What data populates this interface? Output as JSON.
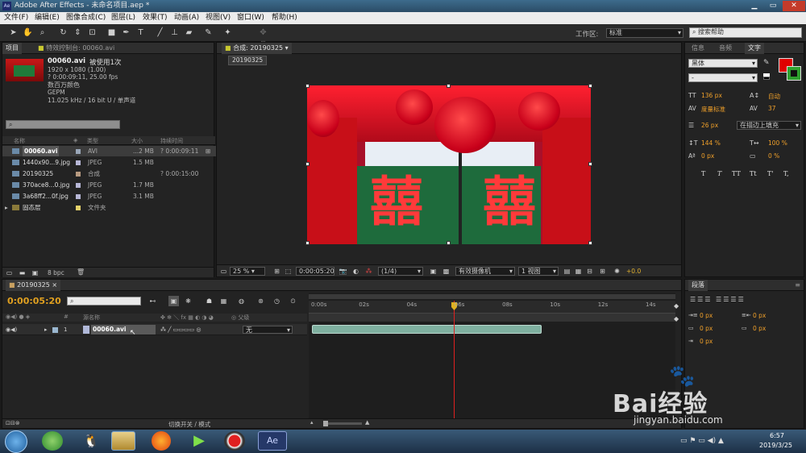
{
  "window": {
    "title": "Adobe After Effects - 未命名项目.aep *",
    "app_icon": "Ae"
  },
  "menu": [
    "文件(F)",
    "编辑(E)",
    "图像合成(C)",
    "图层(L)",
    "效果(T)",
    "动画(A)",
    "视图(V)",
    "窗口(W)",
    "帮助(H)"
  ],
  "toolbar": {
    "workspace_label": "工作区:",
    "workspace_value": "标准",
    "search_help_placeholder": "搜索帮助"
  },
  "project_panel": {
    "tabs": [
      "项目",
      "特效控制台: 00060.avi"
    ],
    "selected_file": {
      "name": "00060.avi",
      "used": "被使用1次",
      "dims": "1920 x 1080 (1.00)",
      "duration": "? 0:00:09:11, 25.00 fps",
      "color": "数百万颜色",
      "codec": "GEPM",
      "audio": "11.025 kHz / 16 bit U / 单声道"
    },
    "columns": {
      "name": "名称",
      "type": "类型",
      "size": "大小",
      "duration": "持续时间"
    },
    "rows": [
      {
        "name": "00060.avi",
        "type": "AVI",
        "size": "...2 MB",
        "duration": "? 0:00:09:11",
        "color": "#9aa7b8"
      },
      {
        "name": "1440x90...9.jpg",
        "type": "JPEG",
        "size": "1.5 MB",
        "duration": "",
        "color": "#b7b7d6"
      },
      {
        "name": "20190325",
        "type": "合成",
        "size": "",
        "duration": "? 0:00:15:00",
        "color": "#b79a80"
      },
      {
        "name": "370ace8...0.jpg",
        "type": "JPEG",
        "size": "1.7 MB",
        "duration": "",
        "color": "#b7b7d6"
      },
      {
        "name": "3a68ff2...0f.jpg",
        "type": "JPEG",
        "size": "3.1 MB",
        "duration": "",
        "color": "#b7b7d6"
      },
      {
        "name": "固态层",
        "type": "文件夹",
        "size": "",
        "duration": "",
        "color": "#e6d26a"
      }
    ],
    "bpc": "8 bpc"
  },
  "comp_panel": {
    "tab": "合成: 20190325",
    "breadcrumb": "20190325",
    "zoom": "25 %",
    "timecode": "0:00:05:20",
    "resolution": "(1/4)",
    "camera": "有效摄像机",
    "views": "1 视图",
    "exposure": "+0.0",
    "scene_chars": [
      "囍",
      "囍"
    ]
  },
  "right_panels": {
    "tabs": [
      "信息",
      "音频",
      "文字"
    ],
    "font": "黑体",
    "style": "-",
    "font_size": "136 px",
    "leading": "自动",
    "kerning": "度量标准",
    "tracking": "37",
    "stroke_width": "26 px",
    "stroke_type": "在描边上填充",
    "vscale": "144 %",
    "hscale": "100 %",
    "baseline": "0 px",
    "tsume": "0 %",
    "style_buttons": [
      "T",
      "T",
      "TT",
      "Tt",
      "T'",
      "T,"
    ],
    "colors": {
      "fill": "#e00000",
      "stroke": "#2fa02f"
    }
  },
  "paragraph_panel": {
    "tab": "段落",
    "fields": [
      "0 px",
      "0 px",
      "0 px",
      "0 px",
      "0 px"
    ]
  },
  "timeline": {
    "tab": "20190325",
    "timecode": "0:00:05:20",
    "ruler": [
      "0:00s",
      "02s",
      "04s",
      "06s",
      "08s",
      "10s",
      "12s",
      "14s"
    ],
    "headers": {
      "source": "源名称",
      "parent": "父级"
    },
    "layer": {
      "index": "1",
      "name": "00060.avi",
      "parent": "无"
    },
    "footer": "切换开关 / 模式",
    "playhead_fraction": 0.389,
    "clip_start_fraction": 0.0,
    "clip_end_fraction": 0.627
  },
  "taskbar": {
    "time": "6:57",
    "date": "2019/3/25",
    "ae_label": "Ae"
  },
  "watermark": {
    "text": "Bai经验",
    "url": "jingyan.baidu.com"
  }
}
